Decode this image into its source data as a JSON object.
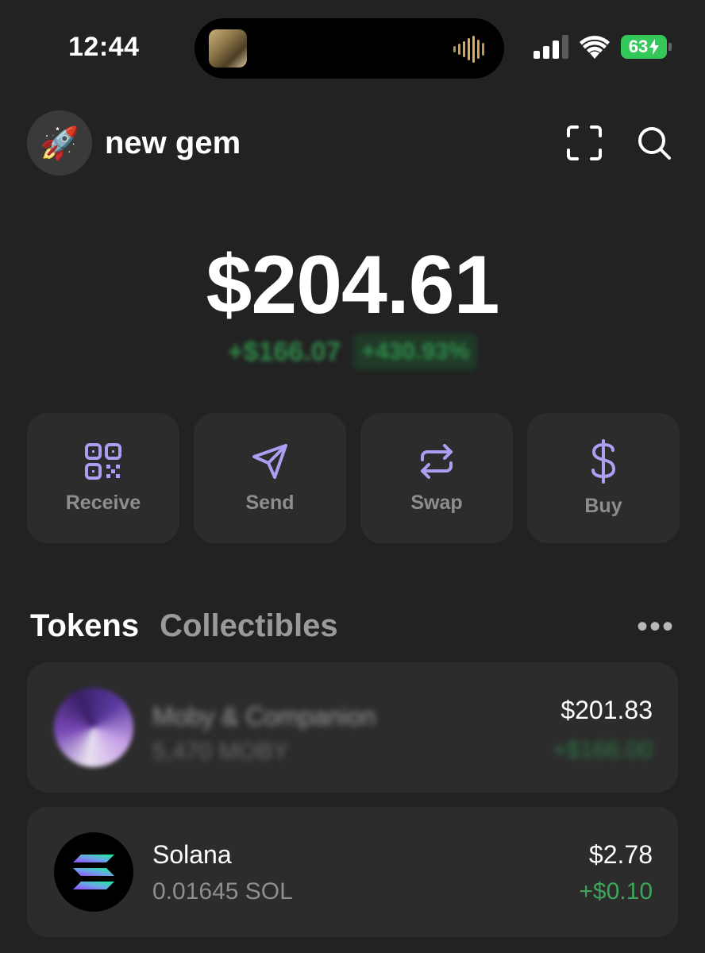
{
  "status_bar": {
    "time": "12:44",
    "battery": "63"
  },
  "header": {
    "avatar_emoji": "🚀",
    "account_name": "new gem"
  },
  "balance": {
    "total": "$204.61",
    "change_value": "+$166.07",
    "change_percent": "+430.93%"
  },
  "actions": [
    {
      "label": "Receive",
      "icon": "qr-code-icon"
    },
    {
      "label": "Send",
      "icon": "send-icon"
    },
    {
      "label": "Swap",
      "icon": "swap-icon"
    },
    {
      "label": "Buy",
      "icon": "dollar-icon"
    }
  ],
  "tabs": {
    "tokens": "Tokens",
    "collectibles": "Collectibles",
    "more": "•••"
  },
  "tokens": [
    {
      "name": "Moby & Companion",
      "amount": "5,470 MOBY",
      "value": "$201.83",
      "change": "+$166.00",
      "obscured": true
    },
    {
      "name": "Solana",
      "amount": "0.01645 SOL",
      "value": "$2.78",
      "change": "+$0.10",
      "obscured": false
    }
  ],
  "colors": {
    "background": "#222222",
    "card": "#2c2c2c",
    "accent_purple": "#ab9ff2",
    "positive_green": "#3ea65a"
  }
}
